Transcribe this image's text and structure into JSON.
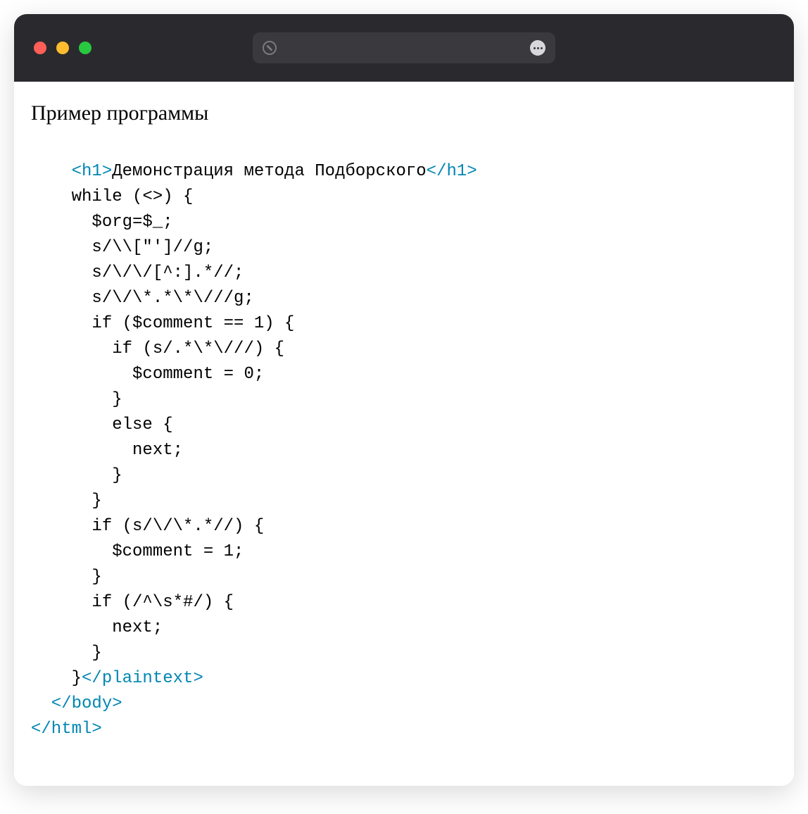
{
  "titlebar": {
    "url": ""
  },
  "page": {
    "title": "Пример программы"
  },
  "code": {
    "h1_open": "<h1>",
    "h1_text": "Демонстрация метода Подборского",
    "h1_close": "</h1>",
    "line02": "    while (<>) {",
    "line03": "      $org=$_;",
    "line04": "      s/\\\\[\"']//g;",
    "line05": "      s/\\/\\/[^:].*//;",
    "line06": "      s/\\/\\*.*\\*\\///g;",
    "line07": "      if ($comment == 1) {",
    "line08": "        if (s/.*\\*\\///) {",
    "line09": "          $comment = 0;",
    "line10": "        }",
    "line11": "        else {",
    "line12": "          next;",
    "line13": "        }",
    "line14": "      }",
    "line15": "      if (s/\\/\\*.*//) {",
    "line16": "        $comment = 1;",
    "line17": "      }",
    "line18": "      if (/^\\s*#/) {",
    "line19": "        next;",
    "line20": "      }",
    "line21_text": "    }",
    "line21_tag": "</plaintext>",
    "line22": "  </body>",
    "line23": "</html>"
  }
}
